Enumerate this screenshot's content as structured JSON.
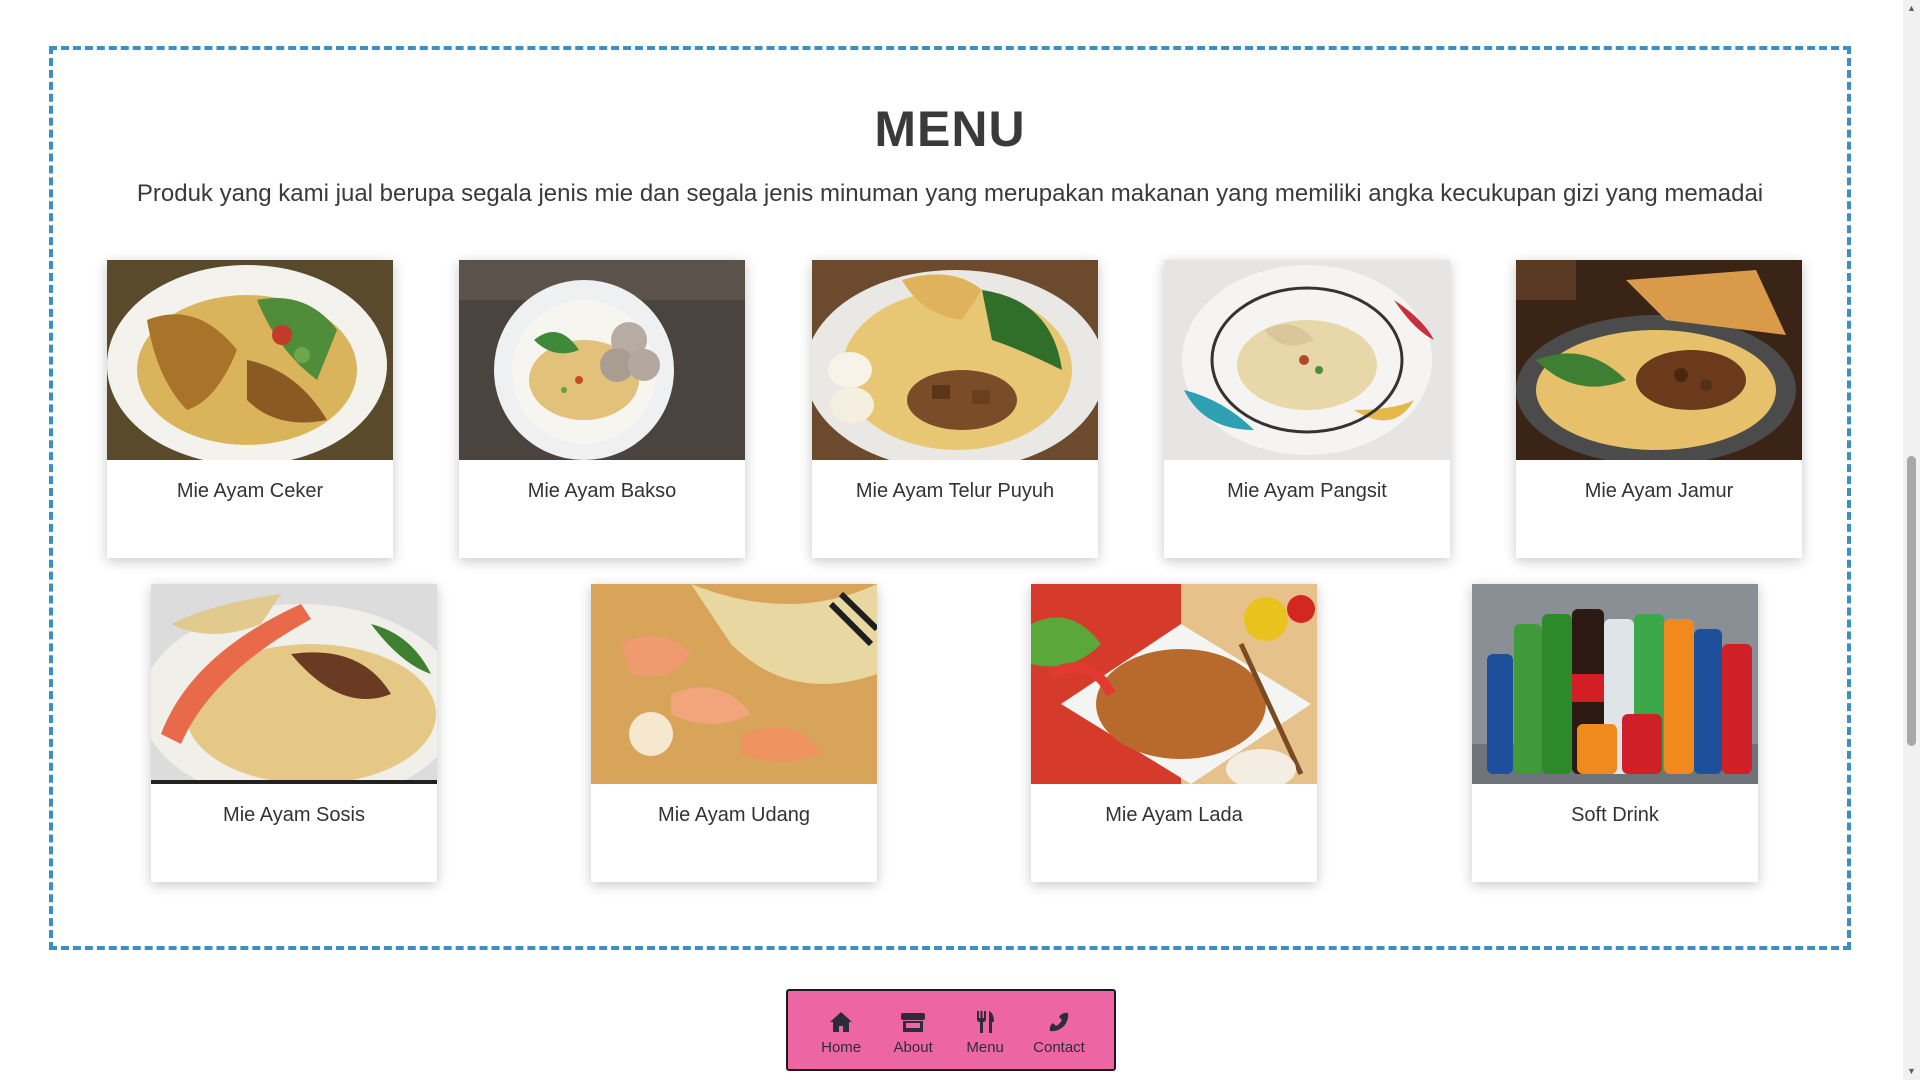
{
  "menu": {
    "title": "MENU",
    "subtitle": "Produk yang kami jual berupa segala jenis mie dan segala jenis minuman yang merupakan makanan yang memiliki angka kecukupan gizi yang memadai",
    "items": [
      {
        "label": "Mie Ayam Ceker",
        "image": "mie-ayam-ceker-photo"
      },
      {
        "label": "Mie Ayam Bakso",
        "image": "mie-ayam-bakso-photo"
      },
      {
        "label": "Mie Ayam Telur Puyuh",
        "image": "mie-ayam-telur-puyuh-photo"
      },
      {
        "label": "Mie Ayam Pangsit",
        "image": "mie-ayam-pangsit-photo"
      },
      {
        "label": "Mie Ayam Jamur",
        "image": "mie-ayam-jamur-photo"
      },
      {
        "label": "Mie Ayam Sosis",
        "image": "mie-ayam-sosis-photo"
      },
      {
        "label": "Mie Ayam Udang",
        "image": "mie-ayam-udang-photo"
      },
      {
        "label": "Mie Ayam Lada",
        "image": "mie-ayam-lada-photo"
      },
      {
        "label": "Soft Drink",
        "image": "soft-drink-photo"
      }
    ]
  },
  "nav": {
    "items": [
      {
        "label": "Home",
        "icon": "home-icon"
      },
      {
        "label": "About",
        "icon": "store-icon"
      },
      {
        "label": "Menu",
        "icon": "utensils-icon"
      },
      {
        "label": "Contact",
        "icon": "phone-icon"
      }
    ]
  },
  "colors": {
    "section_border": "#3b8fc2",
    "nav_background": "#ee65a4",
    "text": "#333333"
  }
}
